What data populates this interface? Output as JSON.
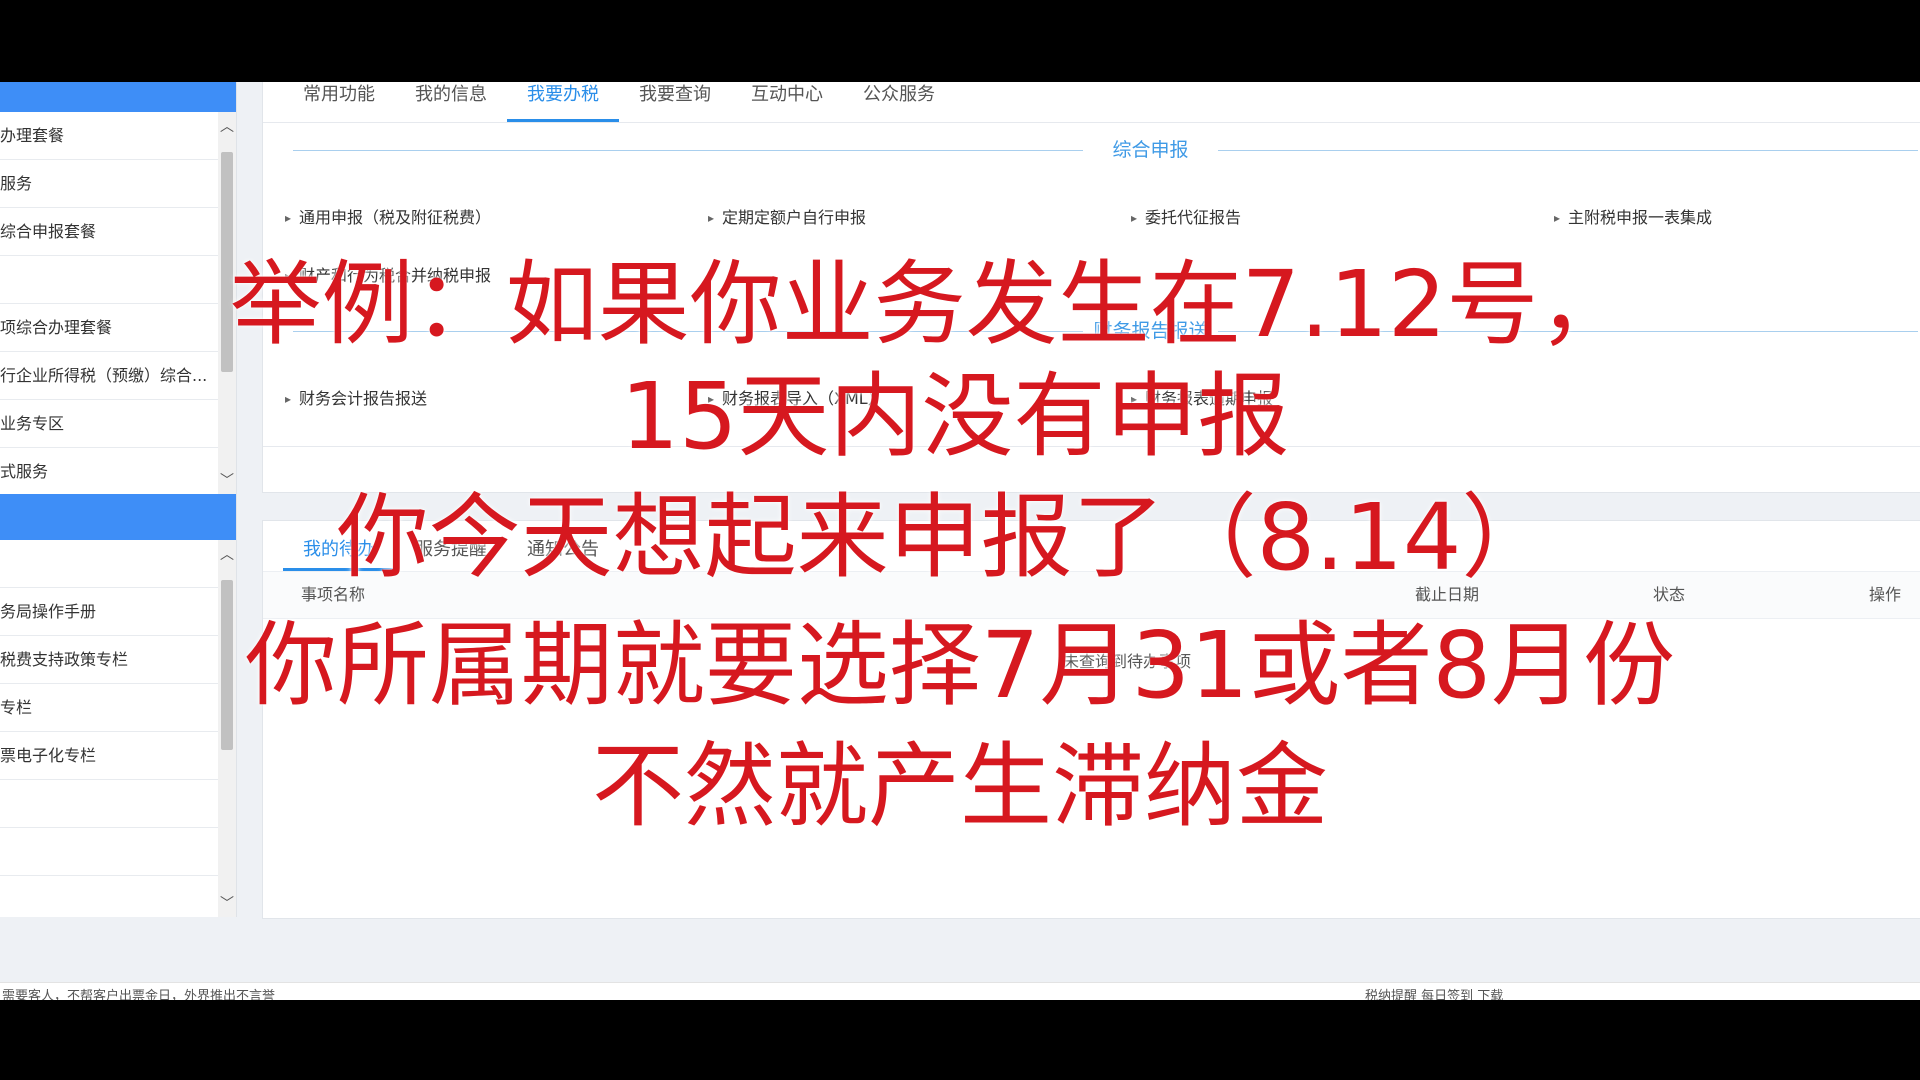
{
  "sidebar": {
    "group1_items": [
      "办理套餐",
      "服务",
      "综合申报套餐",
      "",
      "项综合办理套餐",
      "行企业所得税（预缴）综合...",
      "业务专区",
      "式服务"
    ],
    "group2_items": [
      "",
      "务局操作手册",
      "税费支持政策专栏",
      "专栏",
      "票电子化专栏",
      "",
      ""
    ]
  },
  "tabs": [
    "常用功能",
    "我的信息",
    "我要办税",
    "我要查询",
    "互动中心",
    "公众服务"
  ],
  "section1": {
    "title": "综合申报",
    "items": [
      "通用申报（税及附征税费）",
      "定期定额户自行申报",
      "委托代征报告",
      "主附税申报一表集成",
      "财产和行为税合并纳税申报"
    ]
  },
  "section2": {
    "title": "财务报告报送",
    "items": [
      "财务会计报告报送",
      "财务报表导入（XML）",
      "财务报表逾期申报"
    ]
  },
  "todo": {
    "tabs": [
      "我的待办",
      "服务提醒",
      "通知公告"
    ],
    "columns": [
      "事项名称",
      "截止日期",
      "状态",
      "操作"
    ],
    "empty_text": "未查询到待办事项"
  },
  "statusbar": {
    "left": "需要客人，不帮客户出票金日，外界推出不言誉",
    "right": "税纳提醒  每日签到  下载"
  },
  "caption": [
    "举例：如果你业务发生在7.12号，",
    "15天内没有申报",
    "你今天想起来申报了（8.14）",
    "你所属期就要选择7月31或者8月份",
    "不然就产生滞纳金"
  ]
}
